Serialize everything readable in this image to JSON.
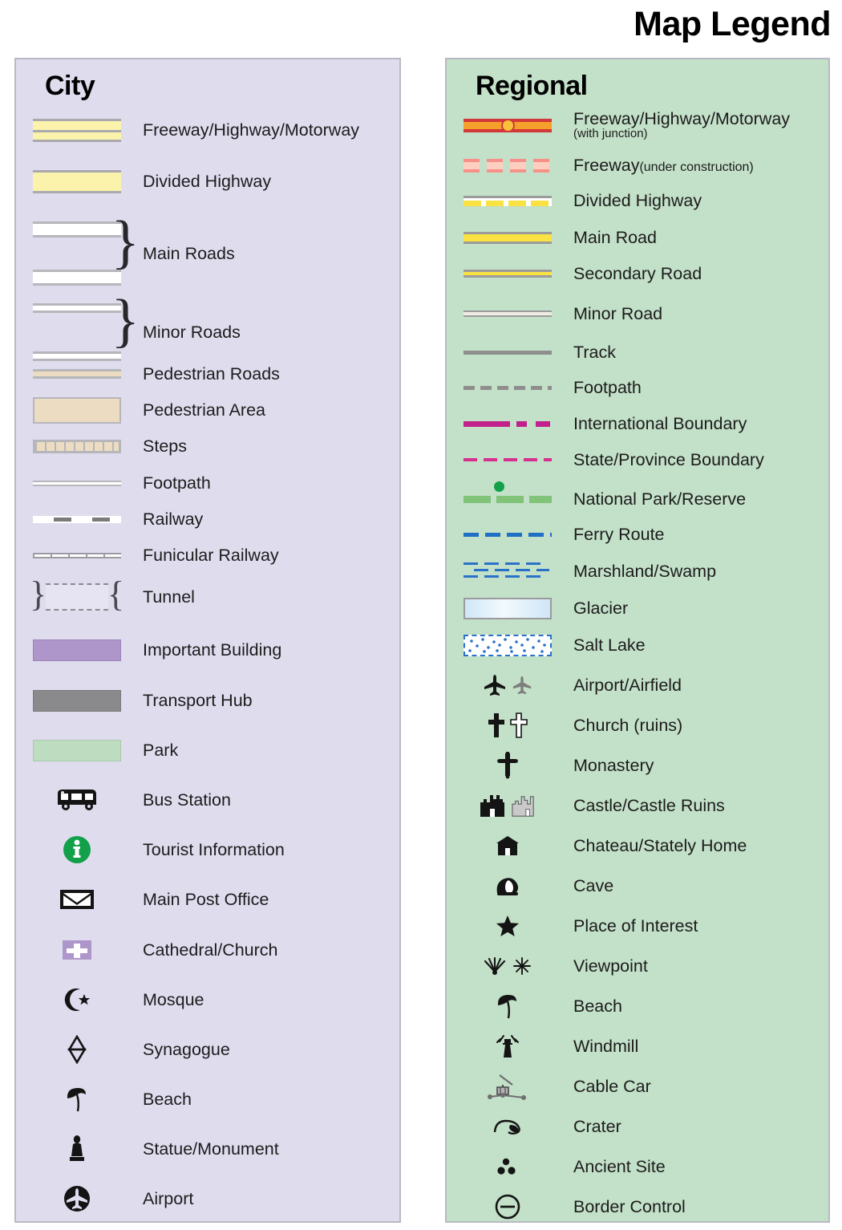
{
  "title": "Map Legend",
  "city": {
    "heading": "City",
    "items": [
      {
        "label": "Freeway/Highway/Motorway",
        "symbol": "freeway-divided-yellow"
      },
      {
        "label": "Divided Highway",
        "symbol": "divided-highway-yellow"
      },
      {
        "label": "Main Roads",
        "symbol": "main-roads-white-pair",
        "grouped": true
      },
      {
        "label": "Minor Roads",
        "symbol": "minor-roads-white-pair",
        "grouped": true
      },
      {
        "label": "Pedestrian Roads",
        "symbol": "pedestrian-road-tan"
      },
      {
        "label": "Pedestrian Area",
        "symbol": "pedestrian-area-tan-block"
      },
      {
        "label": "Steps",
        "symbol": "steps-hatched-tan"
      },
      {
        "label": "Footpath",
        "symbol": "footpath-thin-white"
      },
      {
        "label": "Railway",
        "symbol": "railway-dashed-grey"
      },
      {
        "label": "Funicular Railway",
        "symbol": "funicular-ticked-line"
      },
      {
        "label": "Tunnel",
        "symbol": "tunnel-bracketed-dashed"
      },
      {
        "label": "Important Building",
        "symbol": "important-building-purple-block"
      },
      {
        "label": "Transport Hub",
        "symbol": "transport-hub-grey-block"
      },
      {
        "label": "Park",
        "symbol": "park-green-block"
      },
      {
        "label": "Bus Station",
        "symbol": "bus-icon"
      },
      {
        "label": "Tourist Information",
        "symbol": "information-icon"
      },
      {
        "label": "Main Post Office",
        "symbol": "envelope-icon"
      },
      {
        "label": "Cathedral/Church",
        "symbol": "cathedral-cross-icon"
      },
      {
        "label": "Mosque",
        "symbol": "crescent-star-icon"
      },
      {
        "label": "Synagogue",
        "symbol": "star-of-david-icon"
      },
      {
        "label": "Beach",
        "symbol": "beach-umbrella-icon"
      },
      {
        "label": "Statue/Monument",
        "symbol": "statue-icon"
      },
      {
        "label": "Airport",
        "symbol": "airport-circle-plane-icon"
      }
    ]
  },
  "regional": {
    "heading": "Regional",
    "items": [
      {
        "label": "Freeway/Highway/Motorway",
        "sublabel": "(with junction)",
        "symbol": "freeway-red-orange-with-junction"
      },
      {
        "label": "Freeway",
        "inline_sublabel": "(under construction)",
        "symbol": "freeway-under-construction-dashed"
      },
      {
        "label": "Divided Highway",
        "symbol": "divided-highway-yellow-dashed"
      },
      {
        "label": "Main Road",
        "symbol": "main-road-yellow"
      },
      {
        "label": "Secondary Road",
        "symbol": "secondary-road-yellow-thin"
      },
      {
        "label": "Minor Road",
        "symbol": "minor-road-white-thin"
      },
      {
        "label": "Track",
        "symbol": "track-solid-grey"
      },
      {
        "label": "Footpath",
        "symbol": "footpath-dashed-grey"
      },
      {
        "label": "International Boundary",
        "symbol": "international-boundary-magenta"
      },
      {
        "label": "State/Province Boundary",
        "symbol": "state-boundary-magenta-dashed"
      },
      {
        "label": "National Park/Reserve",
        "symbol": "national-park-green-dashed-dot"
      },
      {
        "label": "Ferry Route",
        "symbol": "ferry-route-blue-dashed"
      },
      {
        "label": "Marshland/Swamp",
        "symbol": "marshland-blue-ticks"
      },
      {
        "label": "Glacier",
        "symbol": "glacier-blue-gradient-block"
      },
      {
        "label": "Salt Lake",
        "symbol": "salt-lake-dotted-block"
      },
      {
        "label": "Airport/Airfield",
        "symbol": "plane-pair-icon"
      },
      {
        "label": "Church (ruins)",
        "symbol": "cross-pair-icon"
      },
      {
        "label": "Monastery",
        "symbol": "orthodox-cross-icon"
      },
      {
        "label": "Castle/Castle Ruins",
        "symbol": "castle-pair-icon"
      },
      {
        "label": "Chateau/Stately Home",
        "symbol": "chateau-icon"
      },
      {
        "label": "Cave",
        "symbol": "cave-icon"
      },
      {
        "label": "Place of Interest",
        "symbol": "star-icon"
      },
      {
        "label": "Viewpoint",
        "symbol": "viewpoint-pair-icon"
      },
      {
        "label": "Beach",
        "symbol": "beach-umbrella-icon"
      },
      {
        "label": "Windmill",
        "symbol": "windmill-icon"
      },
      {
        "label": "Cable Car",
        "symbol": "cable-car-icon"
      },
      {
        "label": "Crater",
        "symbol": "crater-icon"
      },
      {
        "label": "Ancient Site",
        "symbol": "ancient-site-dots-icon"
      },
      {
        "label": "Border Control",
        "symbol": "border-control-icon"
      }
    ]
  },
  "colors": {
    "city_panel_bg": "#dfdcee",
    "regional_panel_bg": "#c3e0c8",
    "panel_border": "#b9b9c4",
    "road_yellow": "#fbf3ac",
    "regional_yellow": "#fae243",
    "freeway_red": "#d2373a",
    "freeway_orange": "#f5a02a",
    "boundary_magenta": "#c2208a",
    "park_green": "#80c379",
    "ferry_blue": "#1f6fc4",
    "important_building_purple": "#ae96cb",
    "transport_hub_grey": "#8a8a8c",
    "park_block_green": "#bddcc0",
    "pedestrian_tan": "#ecdcc1",
    "tourist_info_green": "#12a04a"
  }
}
